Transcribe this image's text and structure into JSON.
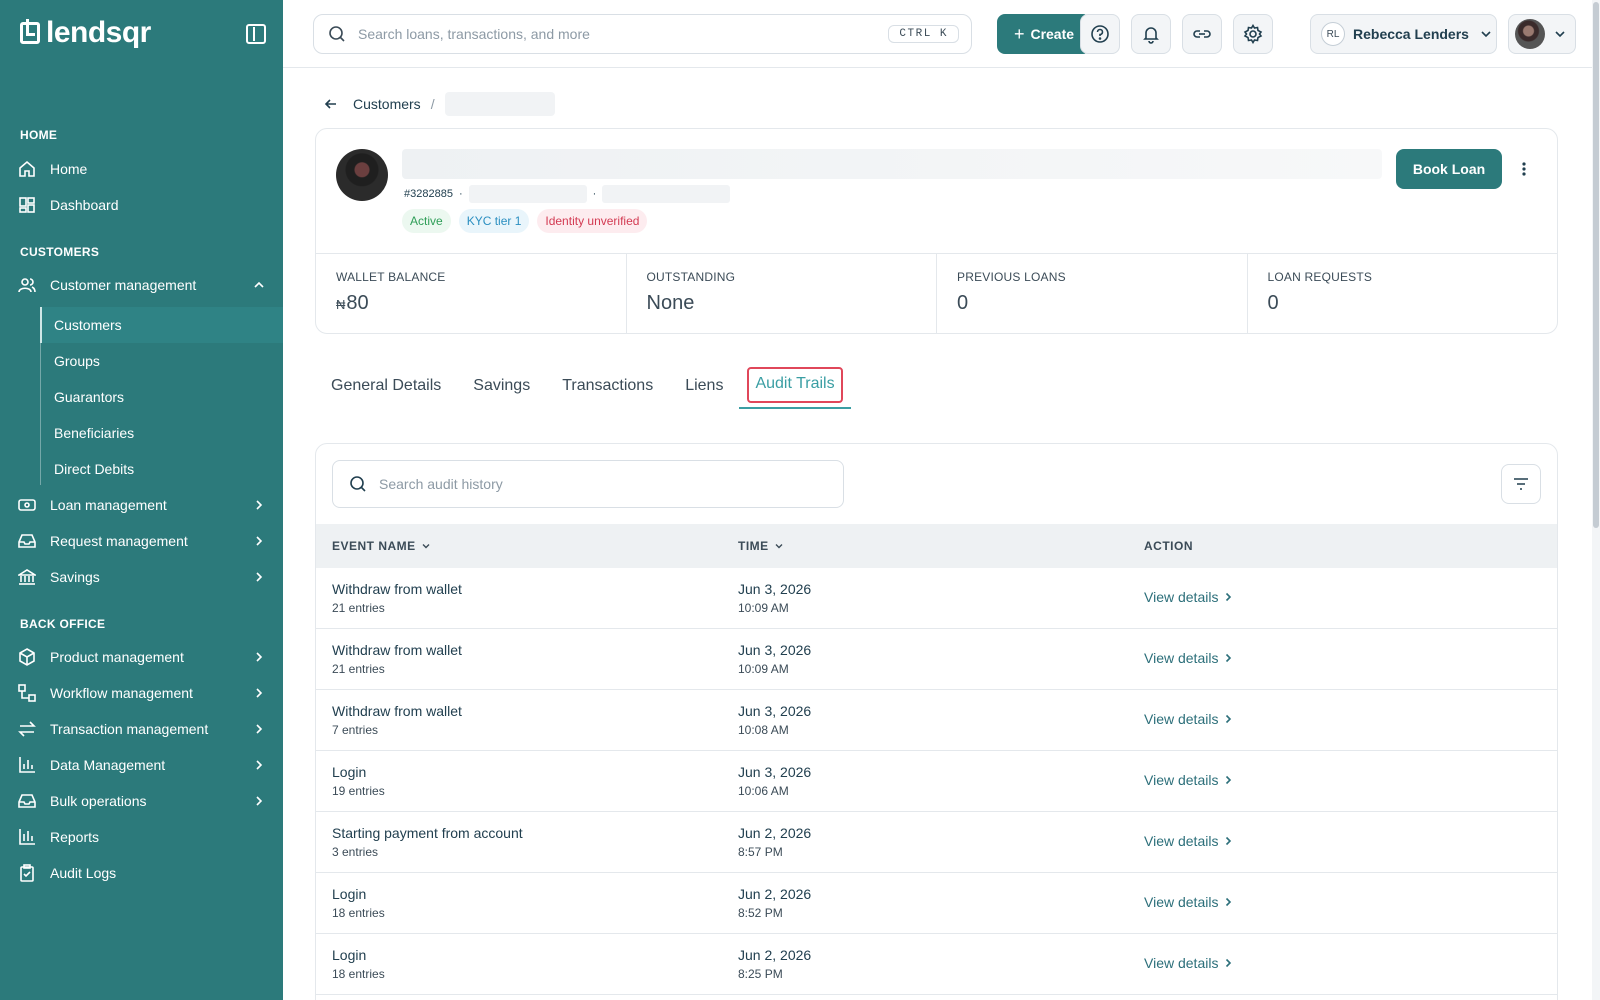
{
  "brand": {
    "name": "lendsqr"
  },
  "sidebar": {
    "sections": {
      "home": "HOME",
      "customers": "CUSTOMERS",
      "back_office": "BACK OFFICE"
    },
    "home_items": [
      "Home",
      "Dashboard"
    ],
    "customer_management": {
      "label": "Customer management",
      "children": [
        "Customers",
        "Groups",
        "Guarantors",
        "Beneficiaries",
        "Direct Debits"
      ],
      "active_child": "Customers"
    },
    "customer_items": [
      "Loan management",
      "Request management",
      "Savings"
    ],
    "back_office_items": [
      "Product management",
      "Workflow management",
      "Transaction management",
      "Data Management",
      "Bulk operations",
      "Reports",
      "Audit Logs"
    ]
  },
  "topbar": {
    "search_placeholder": "Search loans, transactions, and more",
    "shortcut": "CTRL K",
    "create_label": "Create",
    "user_initials": "RL",
    "user_name": "Rebecca Lenders"
  },
  "breadcrumb": {
    "parent": "Customers",
    "separator": "/"
  },
  "customer": {
    "id": "#3282885",
    "badges": {
      "status": "Active",
      "kyc": "KYC tier 1",
      "identity": "Identity unverified"
    },
    "book_loan_label": "Book Loan",
    "stats": [
      {
        "label": "WALLET BALANCE",
        "currency": "₦",
        "value": "80"
      },
      {
        "label": "OUTSTANDING",
        "value": "None"
      },
      {
        "label": "PREVIOUS LOANS",
        "value": "0"
      },
      {
        "label": "LOAN REQUESTS",
        "value": "0"
      }
    ]
  },
  "tabs": [
    "General Details",
    "Savings",
    "Transactions",
    "Liens",
    "Audit Trails"
  ],
  "active_tab": "Audit Trails",
  "audit": {
    "search_placeholder": "Search audit history",
    "columns": {
      "event": "EVENT NAME",
      "time": "TIME",
      "action": "ACTION"
    },
    "action_label": "View details",
    "rows": [
      {
        "event": "Withdraw from wallet",
        "entries": "21 entries",
        "date": "Jun 3, 2026",
        "time": "10:09 AM"
      },
      {
        "event": "Withdraw from wallet",
        "entries": "21 entries",
        "date": "Jun 3, 2026",
        "time": "10:09 AM"
      },
      {
        "event": "Withdraw from wallet",
        "entries": "7 entries",
        "date": "Jun 3, 2026",
        "time": "10:08 AM"
      },
      {
        "event": "Login",
        "entries": "19 entries",
        "date": "Jun 3, 2026",
        "time": "10:06 AM"
      },
      {
        "event": "Starting payment from account",
        "entries": "3 entries",
        "date": "Jun 2, 2026",
        "time": "8:57 PM"
      },
      {
        "event": "Login",
        "entries": "18 entries",
        "date": "Jun 2, 2026",
        "time": "8:52 PM"
      },
      {
        "event": "Login",
        "entries": "18 entries",
        "date": "Jun 2, 2026",
        "time": "8:25 PM"
      }
    ]
  },
  "colors": {
    "brand": "#2c7a7b",
    "tab_active": "#3a9ea3",
    "highlight": "#e0475a"
  }
}
